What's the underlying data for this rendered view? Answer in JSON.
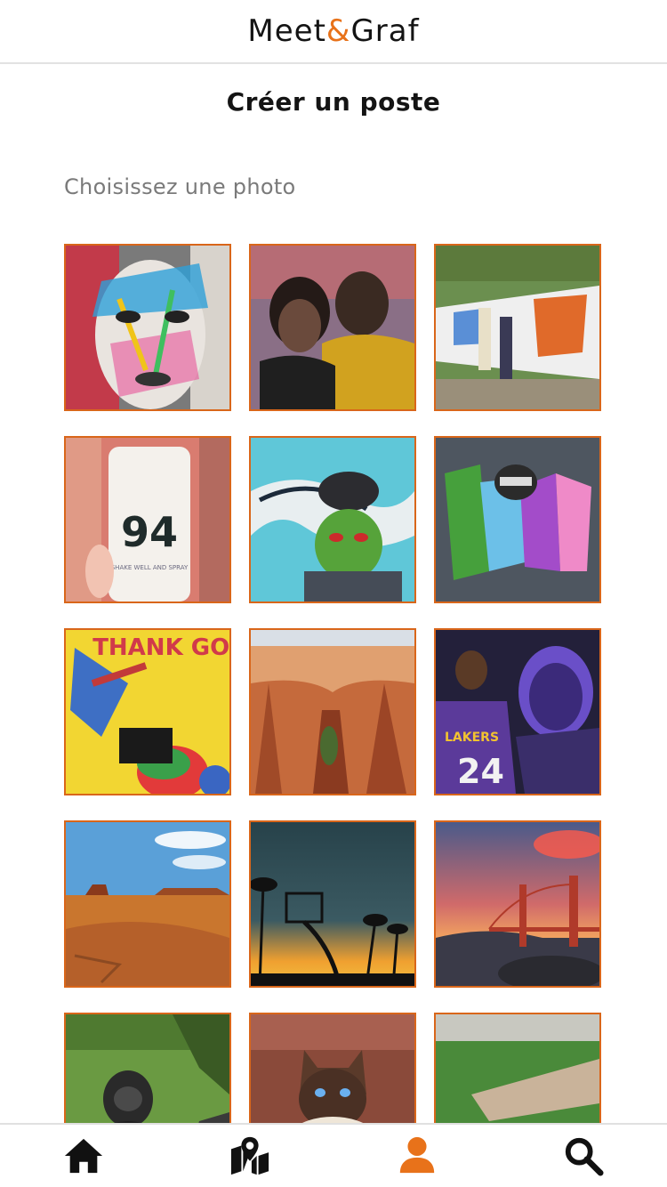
{
  "header": {
    "logo_left": "Meet",
    "logo_amp": "&",
    "logo_right": "Graf"
  },
  "page": {
    "title": "Créer un poste",
    "subtitle": "Choisissez une photo"
  },
  "photos": [
    {
      "name": "photo-graffiti-face-portrait",
      "text": ""
    },
    {
      "name": "photo-kobe-gianna-mural",
      "text": ""
    },
    {
      "name": "photo-kids-painting-wall",
      "text": ""
    },
    {
      "name": "photo-spray-can-94",
      "text": "94",
      "caption": "SHAKE WELL AND SPRAY"
    },
    {
      "name": "photo-green-character-graffiti",
      "text": ""
    },
    {
      "name": "photo-colorful-letters-graffiti",
      "text": ""
    },
    {
      "name": "photo-thank-god-mural",
      "text": "THANK GOD"
    },
    {
      "name": "photo-canyon-hoodoos",
      "text": ""
    },
    {
      "name": "photo-kobe-lakers-24",
      "text": "24",
      "caption": "LAKERS"
    },
    {
      "name": "photo-monument-valley",
      "text": ""
    },
    {
      "name": "photo-basketball-palms-sunset",
      "text": ""
    },
    {
      "name": "photo-golden-gate-sunset",
      "text": ""
    },
    {
      "name": "photo-gorilla",
      "text": ""
    },
    {
      "name": "photo-siamese-cat",
      "text": ""
    },
    {
      "name": "photo-tiger-garden",
      "text": ""
    }
  ],
  "tabbar": {
    "items": [
      {
        "name": "tab-home",
        "icon": "home-icon",
        "active": false
      },
      {
        "name": "tab-map",
        "icon": "map-icon",
        "active": false
      },
      {
        "name": "tab-profile",
        "icon": "user-icon",
        "active": true
      },
      {
        "name": "tab-search",
        "icon": "search-icon",
        "active": false
      }
    ]
  },
  "colors": {
    "accent": "#e8721a",
    "tile_border": "#d9661a",
    "text": "#141414",
    "muted": "#7a7a7a"
  }
}
